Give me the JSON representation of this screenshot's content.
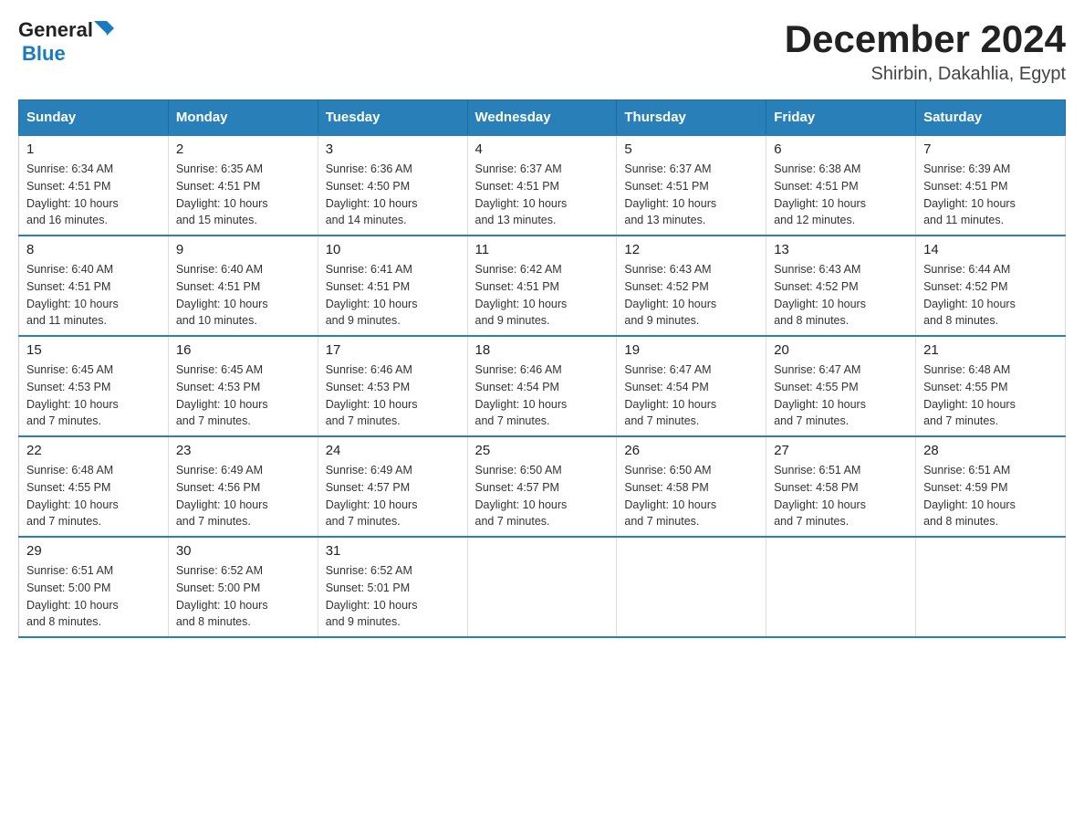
{
  "logo": {
    "general": "General",
    "arrow": "▶",
    "blue": "Blue"
  },
  "title": "December 2024",
  "location": "Shirbin, Dakahlia, Egypt",
  "headers": [
    "Sunday",
    "Monday",
    "Tuesday",
    "Wednesday",
    "Thursday",
    "Friday",
    "Saturday"
  ],
  "weeks": [
    [
      {
        "day": "1",
        "sunrise": "6:34 AM",
        "sunset": "4:51 PM",
        "daylight": "10 hours and 16 minutes."
      },
      {
        "day": "2",
        "sunrise": "6:35 AM",
        "sunset": "4:51 PM",
        "daylight": "10 hours and 15 minutes."
      },
      {
        "day": "3",
        "sunrise": "6:36 AM",
        "sunset": "4:50 PM",
        "daylight": "10 hours and 14 minutes."
      },
      {
        "day": "4",
        "sunrise": "6:37 AM",
        "sunset": "4:51 PM",
        "daylight": "10 hours and 13 minutes."
      },
      {
        "day": "5",
        "sunrise": "6:37 AM",
        "sunset": "4:51 PM",
        "daylight": "10 hours and 13 minutes."
      },
      {
        "day": "6",
        "sunrise": "6:38 AM",
        "sunset": "4:51 PM",
        "daylight": "10 hours and 12 minutes."
      },
      {
        "day": "7",
        "sunrise": "6:39 AM",
        "sunset": "4:51 PM",
        "daylight": "10 hours and 11 minutes."
      }
    ],
    [
      {
        "day": "8",
        "sunrise": "6:40 AM",
        "sunset": "4:51 PM",
        "daylight": "10 hours and 11 minutes."
      },
      {
        "day": "9",
        "sunrise": "6:40 AM",
        "sunset": "4:51 PM",
        "daylight": "10 hours and 10 minutes."
      },
      {
        "day": "10",
        "sunrise": "6:41 AM",
        "sunset": "4:51 PM",
        "daylight": "10 hours and 9 minutes."
      },
      {
        "day": "11",
        "sunrise": "6:42 AM",
        "sunset": "4:51 PM",
        "daylight": "10 hours and 9 minutes."
      },
      {
        "day": "12",
        "sunrise": "6:43 AM",
        "sunset": "4:52 PM",
        "daylight": "10 hours and 9 minutes."
      },
      {
        "day": "13",
        "sunrise": "6:43 AM",
        "sunset": "4:52 PM",
        "daylight": "10 hours and 8 minutes."
      },
      {
        "day": "14",
        "sunrise": "6:44 AM",
        "sunset": "4:52 PM",
        "daylight": "10 hours and 8 minutes."
      }
    ],
    [
      {
        "day": "15",
        "sunrise": "6:45 AM",
        "sunset": "4:53 PM",
        "daylight": "10 hours and 7 minutes."
      },
      {
        "day": "16",
        "sunrise": "6:45 AM",
        "sunset": "4:53 PM",
        "daylight": "10 hours and 7 minutes."
      },
      {
        "day": "17",
        "sunrise": "6:46 AM",
        "sunset": "4:53 PM",
        "daylight": "10 hours and 7 minutes."
      },
      {
        "day": "18",
        "sunrise": "6:46 AM",
        "sunset": "4:54 PM",
        "daylight": "10 hours and 7 minutes."
      },
      {
        "day": "19",
        "sunrise": "6:47 AM",
        "sunset": "4:54 PM",
        "daylight": "10 hours and 7 minutes."
      },
      {
        "day": "20",
        "sunrise": "6:47 AM",
        "sunset": "4:55 PM",
        "daylight": "10 hours and 7 minutes."
      },
      {
        "day": "21",
        "sunrise": "6:48 AM",
        "sunset": "4:55 PM",
        "daylight": "10 hours and 7 minutes."
      }
    ],
    [
      {
        "day": "22",
        "sunrise": "6:48 AM",
        "sunset": "4:55 PM",
        "daylight": "10 hours and 7 minutes."
      },
      {
        "day": "23",
        "sunrise": "6:49 AM",
        "sunset": "4:56 PM",
        "daylight": "10 hours and 7 minutes."
      },
      {
        "day": "24",
        "sunrise": "6:49 AM",
        "sunset": "4:57 PM",
        "daylight": "10 hours and 7 minutes."
      },
      {
        "day": "25",
        "sunrise": "6:50 AM",
        "sunset": "4:57 PM",
        "daylight": "10 hours and 7 minutes."
      },
      {
        "day": "26",
        "sunrise": "6:50 AM",
        "sunset": "4:58 PM",
        "daylight": "10 hours and 7 minutes."
      },
      {
        "day": "27",
        "sunrise": "6:51 AM",
        "sunset": "4:58 PM",
        "daylight": "10 hours and 7 minutes."
      },
      {
        "day": "28",
        "sunrise": "6:51 AM",
        "sunset": "4:59 PM",
        "daylight": "10 hours and 8 minutes."
      }
    ],
    [
      {
        "day": "29",
        "sunrise": "6:51 AM",
        "sunset": "5:00 PM",
        "daylight": "10 hours and 8 minutes."
      },
      {
        "day": "30",
        "sunrise": "6:52 AM",
        "sunset": "5:00 PM",
        "daylight": "10 hours and 8 minutes."
      },
      {
        "day": "31",
        "sunrise": "6:52 AM",
        "sunset": "5:01 PM",
        "daylight": "10 hours and 9 minutes."
      },
      null,
      null,
      null,
      null
    ]
  ],
  "labels": {
    "sunrise": "Sunrise:",
    "sunset": "Sunset:",
    "daylight": "Daylight:"
  }
}
